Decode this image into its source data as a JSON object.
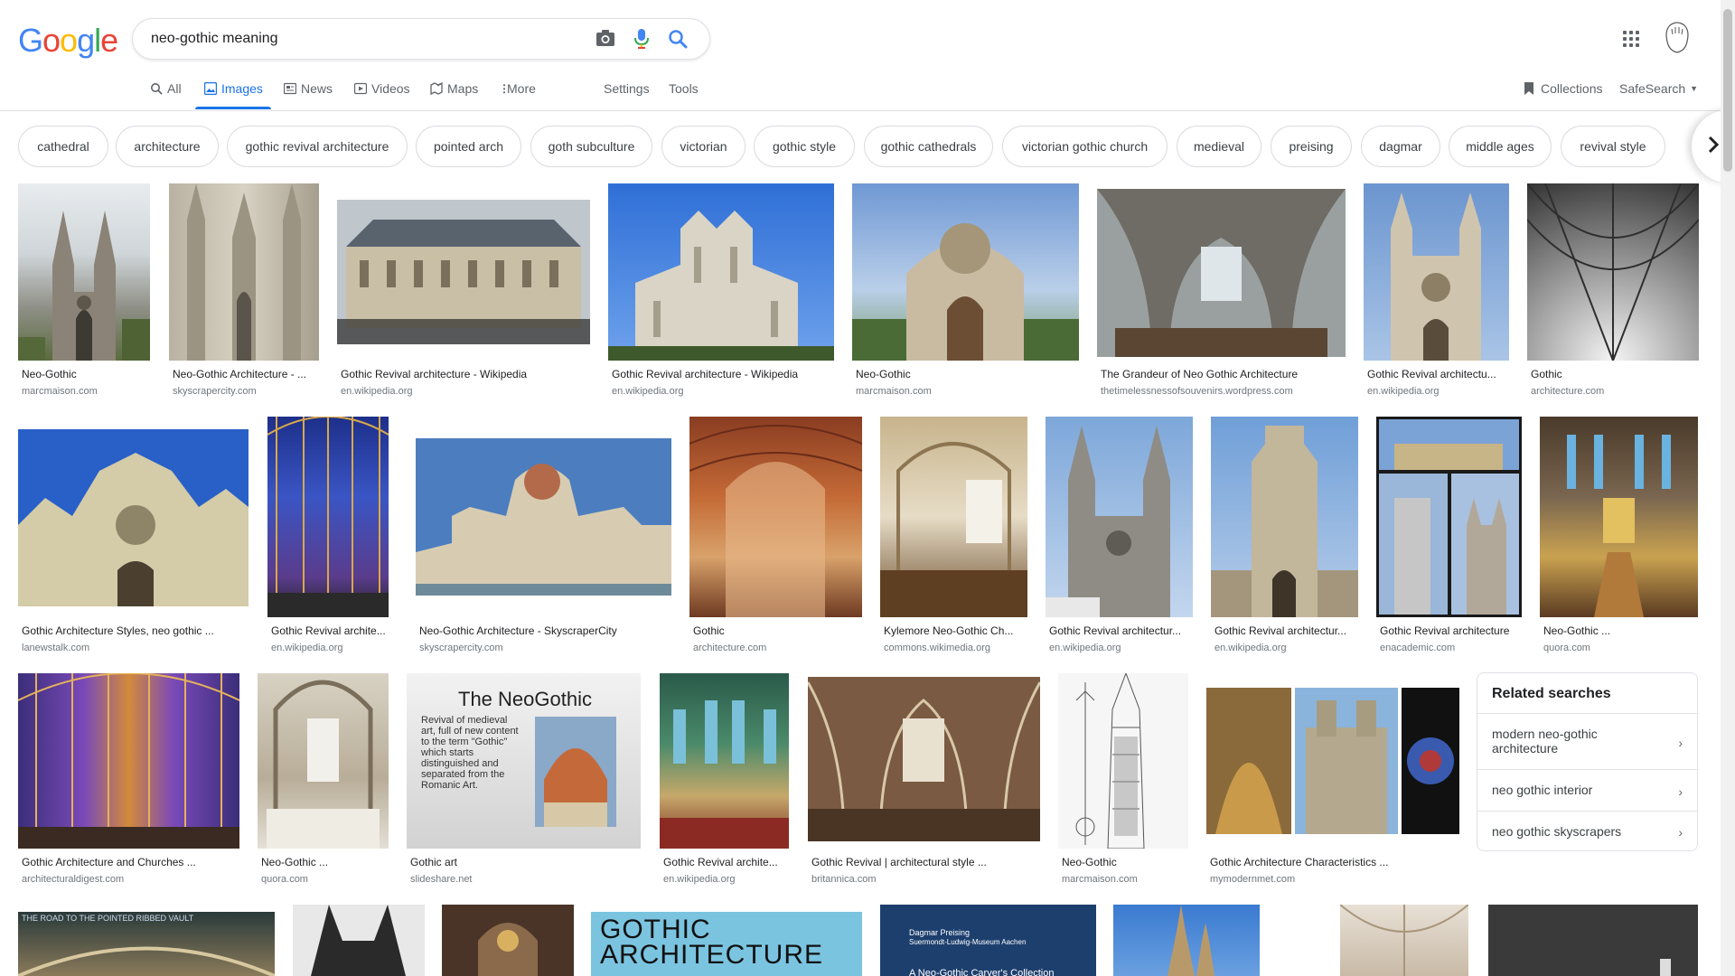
{
  "logo": {
    "text": "Google",
    "letters": [
      "G",
      "o",
      "o",
      "g",
      "l",
      "e"
    ],
    "colors": [
      "#4285f4",
      "#ea4335",
      "#fbbc05",
      "#4285f4",
      "#34a853",
      "#ea4335"
    ]
  },
  "search": {
    "query": "neo-gothic meaning"
  },
  "icons": {
    "camera": "camera-icon",
    "mic": "microphone-icon",
    "search": "search-icon",
    "apps": "apps-grid-icon"
  },
  "nav": {
    "all": "All",
    "images": "Images",
    "news": "News",
    "videos": "Videos",
    "maps": "Maps",
    "more": "More",
    "settings": "Settings",
    "tools": "Tools",
    "collections": "Collections",
    "safesearch": "SafeSearch"
  },
  "chips": [
    "cathedral",
    "architecture",
    "gothic revival architecture",
    "pointed arch",
    "goth subculture",
    "victorian",
    "gothic style",
    "gothic cathedrals",
    "victorian gothic church",
    "medieval",
    "preising",
    "dagmar",
    "middle ages",
    "revival style"
  ],
  "results_row1": [
    {
      "caption": "Neo-Gothic",
      "source": "marcmaison.com"
    },
    {
      "caption": "Neo-Gothic Architecture - ...",
      "source": "skyscrapercity.com"
    },
    {
      "caption": "Gothic Revival architecture - Wikipedia",
      "source": "en.wikipedia.org"
    },
    {
      "caption": "Gothic Revival architecture - Wikipedia",
      "source": "en.wikipedia.org"
    },
    {
      "caption": "Neo-Gothic",
      "source": "marcmaison.com"
    },
    {
      "caption": "The Grandeur of Neo Gothic Architecture",
      "source": "thetimelessnessofsouvenirs.wordpress.com"
    },
    {
      "caption": "Gothic Revival architectu...",
      "source": "en.wikipedia.org"
    },
    {
      "caption": "Gothic",
      "source": "architecture.com"
    }
  ],
  "results_row2": [
    {
      "caption": "Gothic Architecture Styles, neo gothic ...",
      "source": "lanewstalk.com"
    },
    {
      "caption": "Gothic Revival archite...",
      "source": "en.wikipedia.org"
    },
    {
      "caption": "Neo-Gothic Architecture - SkyscraperCity",
      "source": "skyscrapercity.com"
    },
    {
      "caption": "Gothic",
      "source": "architecture.com"
    },
    {
      "caption": "Kylemore Neo-Gothic Ch...",
      "source": "commons.wikimedia.org"
    },
    {
      "caption": "Gothic Revival architectur...",
      "source": "en.wikipedia.org"
    },
    {
      "caption": "Gothic Revival architectur...",
      "source": "en.wikipedia.org"
    },
    {
      "caption": "Gothic Revival architecture",
      "source": "enacademic.com"
    },
    {
      "caption": "Neo-Gothic ...",
      "source": "quora.com"
    }
  ],
  "results_row3": [
    {
      "caption": "Gothic Architecture and Churches ...",
      "source": "architecturaldigest.com"
    },
    {
      "caption": "Neo-Gothic ...",
      "source": "quora.com"
    },
    {
      "caption": "Gothic art",
      "source": "slideshare.net"
    },
    {
      "caption": "Gothic Revival archite...",
      "source": "en.wikipedia.org"
    },
    {
      "caption": "Gothic Revival | architectural style ...",
      "source": "britannica.com"
    },
    {
      "caption": "Neo-Gothic",
      "source": "marcmaison.com"
    },
    {
      "caption": "Gothic Architecture Characteristics ...",
      "source": "mymodernmet.com"
    }
  ],
  "slide_text": {
    "title": "The NeoGothic",
    "body": "Revival of medieval art, full of new content to the term \"Gothic\" which starts distinguished and separated from the Romanic Art."
  },
  "row4_text": {
    "road": "THE ROAD TO THE POINTED RIBBED VAULT",
    "gothic_arch": "GOTHIC ARCHITECTURE",
    "book_author": "Dagmar Preising",
    "book_museum": "Suermondt-Ludwig-Museum Aachen",
    "book_title": "A Neo-Gothic Carver's Collection"
  },
  "related": {
    "title": "Related searches",
    "items": [
      "modern neo-gothic architecture",
      "neo gothic interior",
      "neo gothic skyscrapers"
    ]
  }
}
